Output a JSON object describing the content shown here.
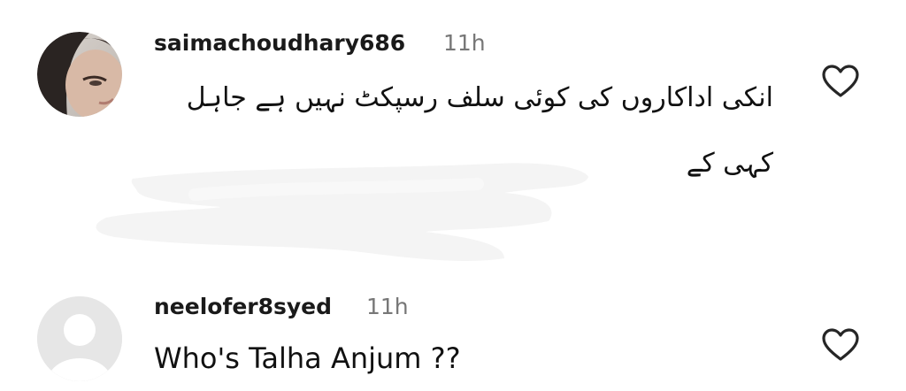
{
  "comments": [
    {
      "username": "saimachoudhary686",
      "time": "11h",
      "text_line1": "انکی اداکاروں کی کوئی سلف رسپکٹ نہیں ہے جاہل",
      "text_line2": "کہی کے",
      "avatar": "profile-photo",
      "like_icon": "heart-outline-icon"
    },
    {
      "username": "neelofer8syed",
      "time": "11h",
      "text": "Who's Talha Anjum ??",
      "avatar": "default-profile-avatar",
      "like_icon": "heart-outline-icon"
    }
  ],
  "colors": {
    "username": "#1a1a1a",
    "time": "#777777",
    "text": "#111111",
    "icon": "#262626",
    "default_avatar_bg": "#e6e6e6",
    "default_avatar_fg": "#ffffff"
  }
}
